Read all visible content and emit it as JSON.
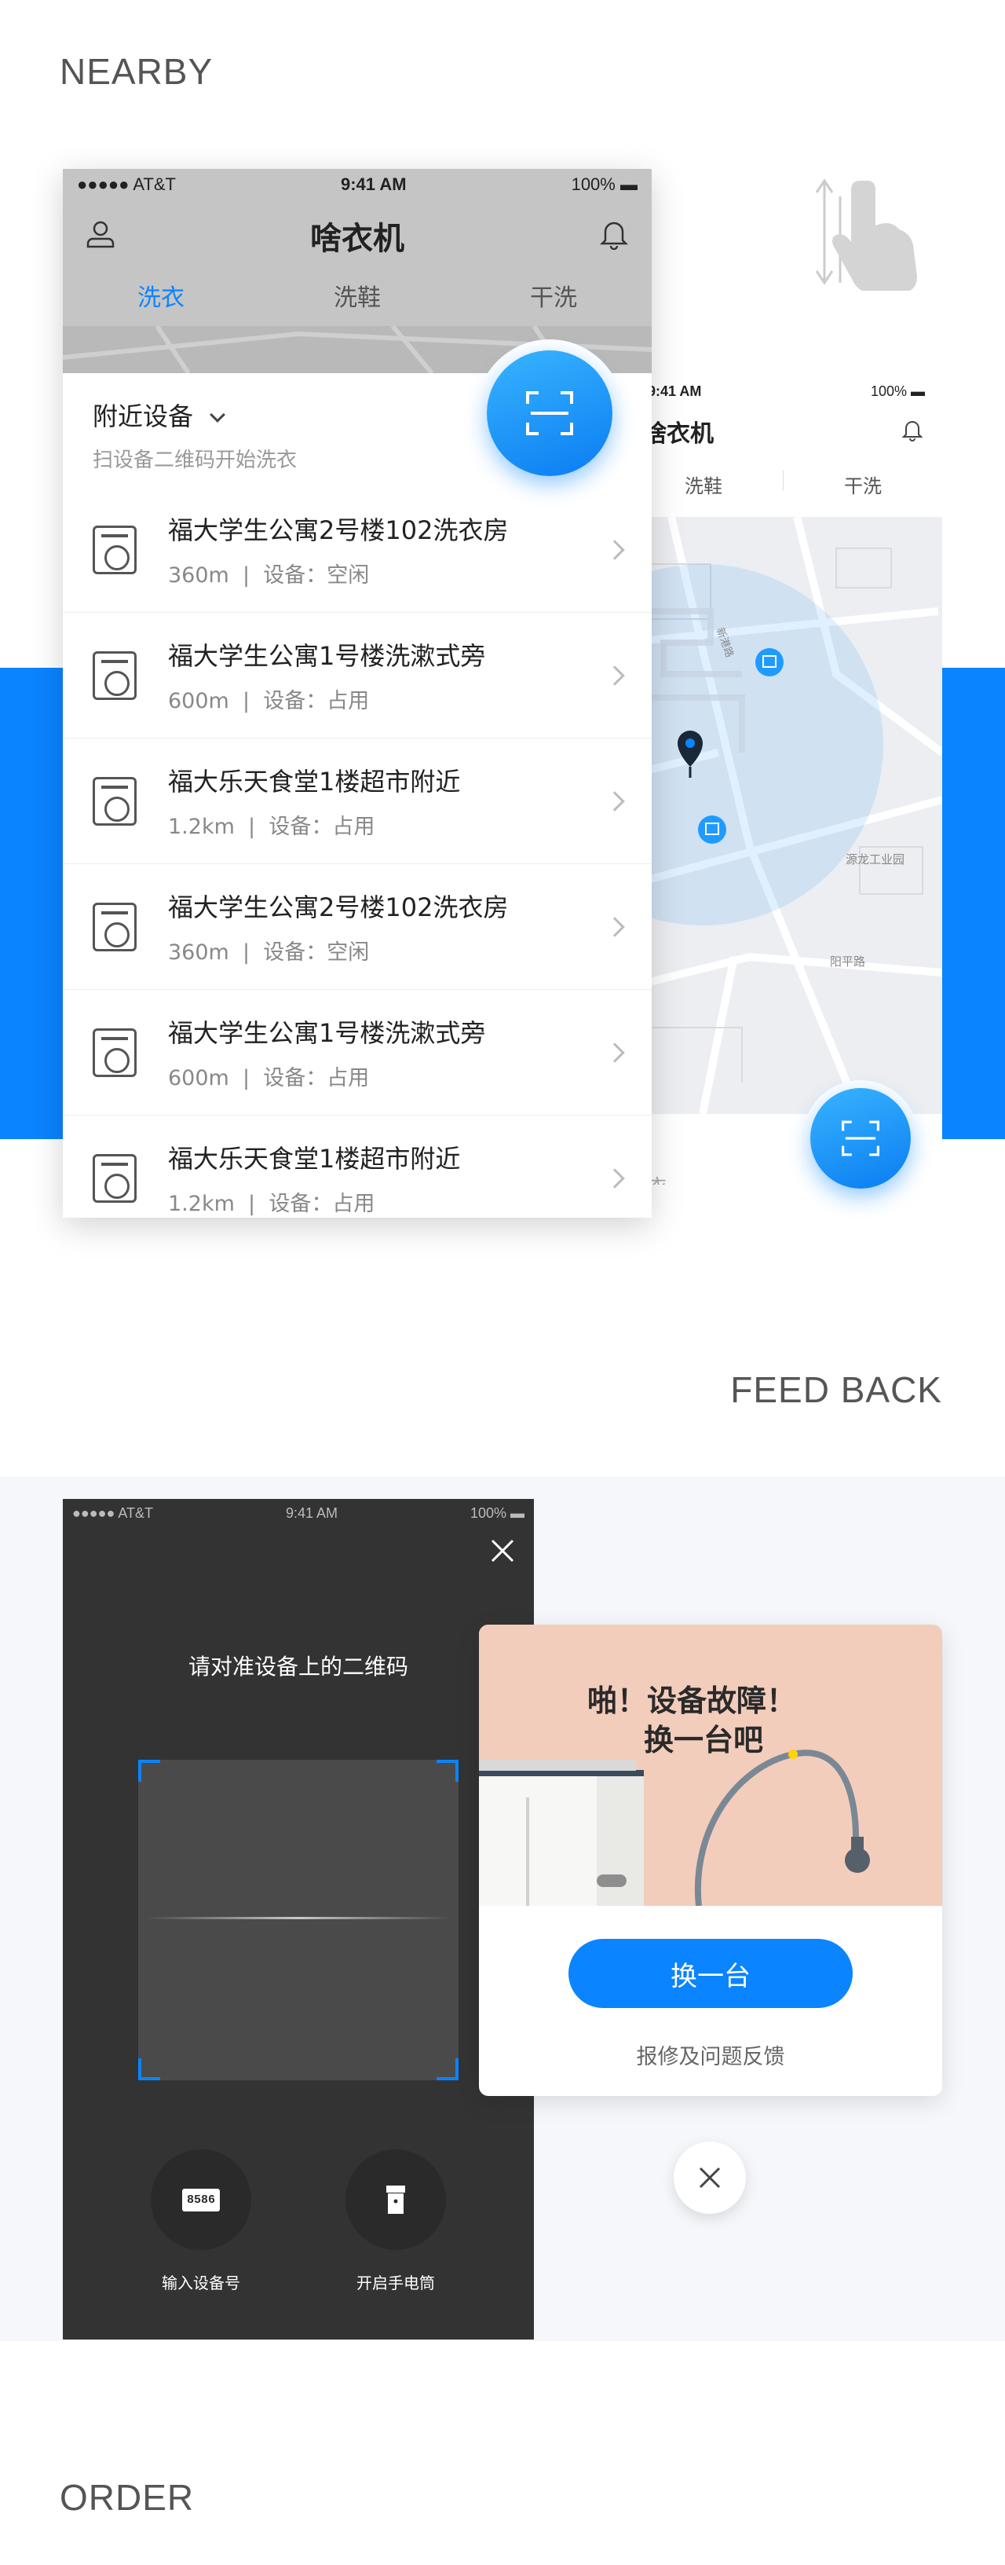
{
  "sections": {
    "nearby": "NEARBY",
    "feedback": "FEED BACK",
    "order": "ORDER"
  },
  "colors": {
    "accent": "#0a84ff",
    "scanner_bg": "#333333",
    "popup_art_bg": "#f3cdbb"
  },
  "phone_list": {
    "status": {
      "carrier": "●●●●● AT&T",
      "time": "9:41 AM",
      "battery": "100%"
    },
    "title": "啥衣机",
    "tabs": [
      "洗衣",
      "洗鞋",
      "干洗"
    ],
    "active_tab": "洗衣",
    "header": {
      "title": "附近设备",
      "subtitle": "扫设备二维码开始洗衣"
    },
    "items": [
      {
        "name": "福大学生公寓2号楼102洗衣房",
        "distance": "360m",
        "status": "设备：空闲"
      },
      {
        "name": "福大学生公寓1号楼洗漱式旁",
        "distance": "600m",
        "status": "设备：占用"
      },
      {
        "name": "福大乐天食堂1楼超市附近",
        "distance": "1.2km",
        "status": "设备：占用"
      },
      {
        "name": "福大学生公寓2号楼102洗衣房",
        "distance": "360m",
        "status": "设备：空闲"
      },
      {
        "name": "福大学生公寓1号楼洗漱式旁",
        "distance": "600m",
        "status": "设备：占用"
      },
      {
        "name": "福大乐天食堂1楼超市附近",
        "distance": "1.2km",
        "status": "设备：占用"
      }
    ]
  },
  "phone_map": {
    "status": {
      "time": "9:41 AM",
      "battery": "100%"
    },
    "title": "啥衣机",
    "tabs": [
      "洗鞋",
      "干洗"
    ],
    "map_labels": [
      "源龙工业园",
      "阳平路",
      "广场",
      "新港路"
    ],
    "footer_text": "衣"
  },
  "scanner": {
    "status": {
      "carrier": "●●●●● AT&T",
      "time": "9:41 AM",
      "battery": "100%"
    },
    "prompt": "请对准设备上的二维码",
    "code_icon_text": "8586",
    "actions": [
      "输入设备号",
      "开启手电筒"
    ]
  },
  "popup": {
    "art_line1": "啪！设备故障！",
    "art_line2": "换一台吧",
    "primary": "换一台",
    "link": "报修及问题反馈"
  }
}
